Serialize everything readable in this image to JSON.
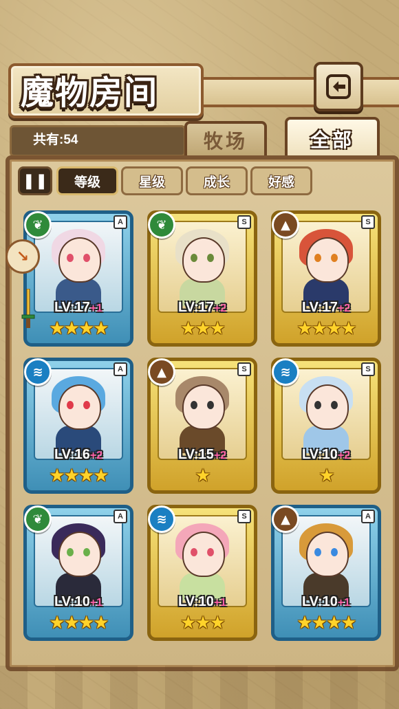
{
  "header": {
    "title": "魔物房间",
    "back_label": "back"
  },
  "count": {
    "text": "共有:54"
  },
  "tabs": [
    {
      "label": "牧场",
      "active": false
    },
    {
      "label": "全部",
      "active": true
    }
  ],
  "sort": {
    "toggle_icon": "pause-sort-icon",
    "buttons": [
      {
        "label": "等级",
        "active": true
      },
      {
        "label": "星级",
        "active": false
      },
      {
        "label": "成长",
        "active": false
      },
      {
        "label": "好感",
        "active": false
      }
    ]
  },
  "monsters": [
    {
      "frame": "blue",
      "element": "leaf",
      "rarity": "A",
      "lv": "LV:17",
      "plus": "+1",
      "stars": "★★★★"
    },
    {
      "frame": "gold",
      "element": "leaf",
      "rarity": "S",
      "lv": "LV:17",
      "plus": "+2",
      "stars": "★★★"
    },
    {
      "frame": "gold",
      "element": "earth",
      "rarity": "S",
      "lv": "LV:17",
      "plus": "+2",
      "stars": "★★★★"
    },
    {
      "frame": "blue",
      "element": "water",
      "rarity": "A",
      "lv": "LV:16",
      "plus": "+2",
      "stars": "★★★★"
    },
    {
      "frame": "gold",
      "element": "earth",
      "rarity": "S",
      "lv": "LV:15",
      "plus": "+2",
      "stars": "★"
    },
    {
      "frame": "gold",
      "element": "water",
      "rarity": "S",
      "lv": "LV:10",
      "plus": "+2",
      "stars": "★"
    },
    {
      "frame": "blue",
      "element": "leaf",
      "rarity": "A",
      "lv": "LV:10",
      "plus": "+1",
      "stars": "★★★★"
    },
    {
      "frame": "gold",
      "element": "water",
      "rarity": "S",
      "lv": "LV:10",
      "plus": "+1",
      "stars": "★★★"
    },
    {
      "frame": "blue",
      "element": "earth",
      "rarity": "A",
      "lv": "LV:10",
      "plus": "+1",
      "stars": "★★★★"
    }
  ],
  "colors": {
    "leaf": "#2f8a3a",
    "water": "#1a7fc2",
    "earth": "#7a4a22",
    "accent": "#ffd32a"
  }
}
